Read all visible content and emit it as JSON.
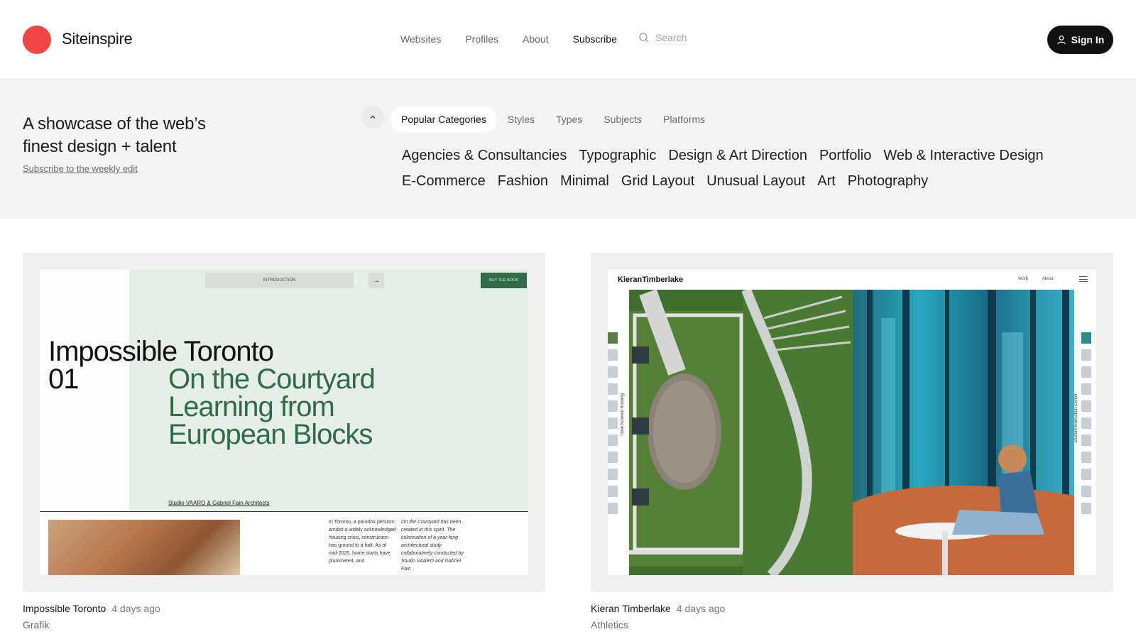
{
  "header": {
    "brand": "Siteinspire",
    "nav": [
      {
        "label": "Websites",
        "active": false
      },
      {
        "label": "Profiles",
        "active": false
      },
      {
        "label": "About",
        "active": false
      },
      {
        "label": "Subscribe",
        "active": true
      }
    ],
    "search_placeholder": "Search",
    "sign_in_label": "Sign In"
  },
  "hero": {
    "tagline": "A showcase of the web’s finest design + talent",
    "subscribe_link": "Subscribe to the weekly edit",
    "tabs": [
      "Popular Categories",
      "Styles",
      "Types",
      "Subjects",
      "Platforms"
    ],
    "active_tab": "Popular Categories",
    "categories": [
      "Agencies & Consultancies",
      "Typographic",
      "Design & Art Direction",
      "Portfolio",
      "Web & Interactive Design",
      "E-Commerce",
      "Fashion",
      "Minimal",
      "Grid Layout",
      "Unusual Layout",
      "Art",
      "Photography"
    ]
  },
  "cards": [
    {
      "title": "Impossible Toronto",
      "time": "4 days ago",
      "tag": "Grafik",
      "screenshot": {
        "intro_pill": "INTRODUCTION",
        "arrow": "→",
        "buy": "BUY THE BOOK",
        "headline_1": "Impossible Toronto 01",
        "headline_2": "On the Courtyard Learning from European Blocks",
        "credit": "Studio VAARO & Gabriel Fain Architects",
        "col1": "In Toronto, a paradox persists: amidst a widely acknowledged housing crisis, construction has ground to a halt. As of mid-2025, home starts have plummeted, and",
        "col2": "On the Courtyard has been created in this spirit. The culmination of a year-long architectural study collaboratively conducted by Studio VAARO and Gabriel Fain"
      }
    },
    {
      "title": "Kieran Timberlake",
      "time": "4 days ago",
      "tag": "Athletics",
      "screenshot": {
        "brand": "KieranTimberlake",
        "nav": [
          "Work",
          "About"
        ],
        "left_label": "New Science Building",
        "right_label": "Student Innovation Center"
      }
    }
  ],
  "colors": {
    "logo": "#ef4444",
    "hero_bg": "#f4f4f4",
    "sign_in_bg": "#111111",
    "accent_green": "#2f6b4a"
  }
}
